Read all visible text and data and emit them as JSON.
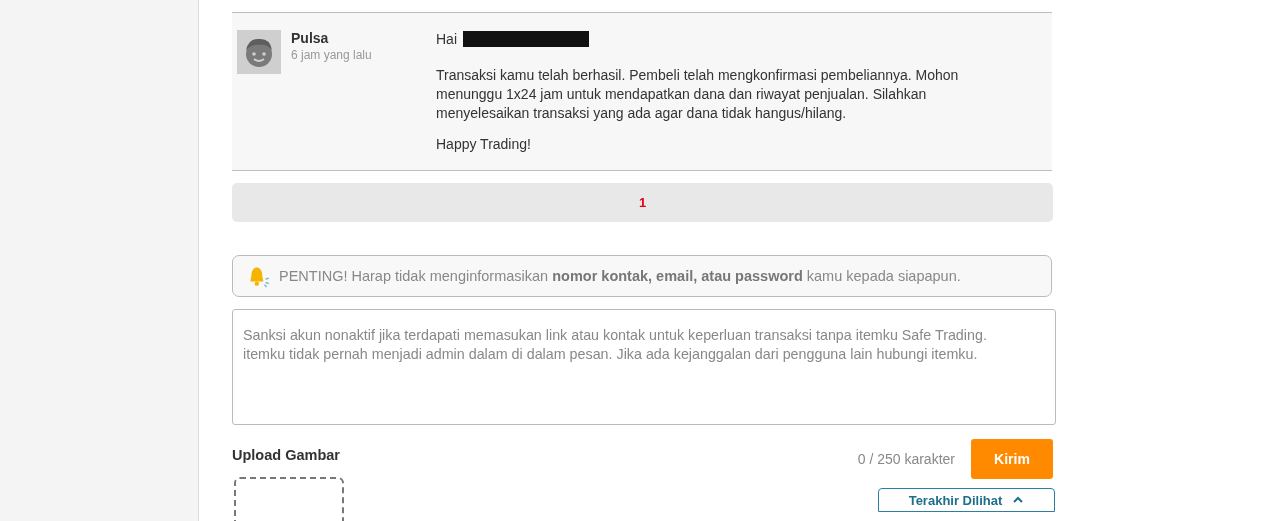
{
  "message": {
    "sender": "Pulsa",
    "time": "6 jam yang lalu",
    "greeting": "Hai",
    "recipient_redacted": true,
    "paragraphs": [
      "Transaksi kamu telah berhasil. Pembeli telah mengkonfirmasi pembeliannya. Mohon menunggu 1x24 jam untuk mendapatkan dana dan riwayat penjualan. Silahkan menyelesaikan transaksi yang ada agar dana tidak hangus/hilang.",
      "Happy Trading!"
    ]
  },
  "pagination": [
    {
      "label": "1",
      "selected": true
    }
  ],
  "notice": "PENTING! Harap tidak menginformasikan **nomor kontak, email, atau password** kamu kepada siapapun.",
  "message_input": {
    "placeholder": "Sanksi akun nonaktif jika terdapati memasukan link atau kontak untuk keperluan transaksi tanpa itemku Safe Trading. itemku tidak pernah menjadi admin dalam di dalam pesan. Jika ada kejanggalan dari pengguna lain hubungi itemku."
  },
  "upload": {
    "label": "Upload Gambar"
  },
  "char_counter": "0 / 250 karakter",
  "send_button": "Kirim",
  "recently_viewed": {
    "label": "Terakhir Dilihat",
    "expanded": false
  }
}
